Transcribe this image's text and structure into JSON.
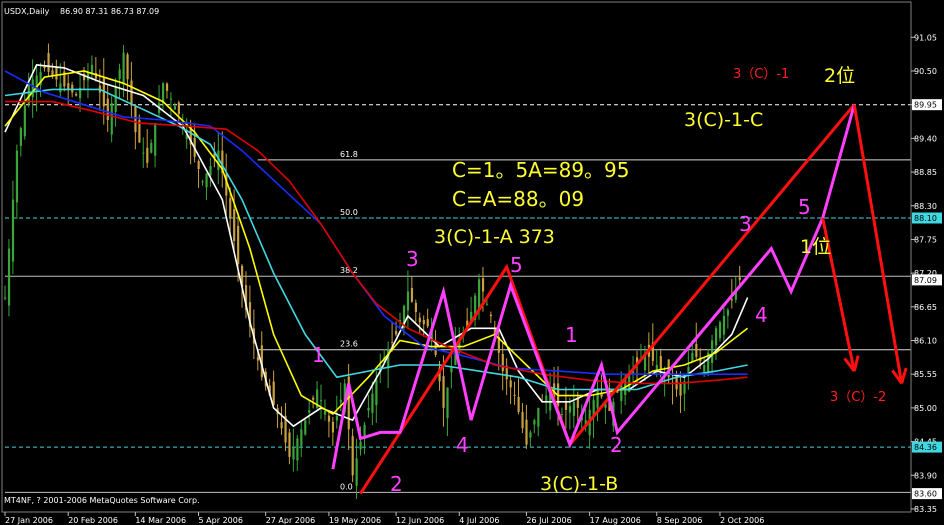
{
  "header": {
    "symbol": "USDX,Daily",
    "ohlc": "86.90 87.31 86.73 87.09"
  },
  "footer": {
    "copyright": "MT4NF, ? 2001-2006 MetaQuotes Software Corp."
  },
  "colors": {
    "background": "#000000",
    "bull": "#3aa63a",
    "bear": "#c8a040",
    "ma_white": "#ffffff",
    "ma_yellow": "#ffff00",
    "ma_cyan": "#40d8e0",
    "ma_blue": "#1a2cff",
    "ma_red": "#e00000",
    "wave_magenta": "#ff40ff",
    "trend_red": "#ff1010",
    "annot_yellow": "#ffff30",
    "label_red": "#ff2020"
  },
  "chart_data": {
    "type": "candlestick",
    "title": "USDX,Daily",
    "ylim": [
      83.3,
      91.3
    ],
    "y_ticks": [
      91.05,
      90.5,
      89.95,
      89.4,
      88.85,
      88.3,
      87.75,
      87.2,
      86.65,
      86.1,
      85.55,
      85.0,
      84.45,
      83.9,
      83.35
    ],
    "y_tick_labels": [
      "91.05",
      "90.50",
      "89.95",
      "89.40",
      "88.85",
      "88.30",
      "87.75",
      "87.20",
      "86.65",
      "86.10",
      "85.55",
      "85.00",
      "84.45",
      "83.90",
      "83.35"
    ],
    "x_ticks": [
      {
        "i": 0,
        "label": "27 Jan 2006"
      },
      {
        "i": 16,
        "label": "20 Feb 2006"
      },
      {
        "i": 33,
        "label": "14 Mar 2006"
      },
      {
        "i": 49,
        "label": "5 Apr 2006"
      },
      {
        "i": 66,
        "label": "27 Apr 2006"
      },
      {
        "i": 82,
        "label": "19 May 2006"
      },
      {
        "i": 99,
        "label": "12 Jun 2006"
      },
      {
        "i": 115,
        "label": "4 Jul 2006"
      },
      {
        "i": 132,
        "label": "26 Jul 2006"
      },
      {
        "i": 148,
        "label": "17 Aug 2006"
      },
      {
        "i": 165,
        "label": "8 Sep 2006"
      },
      {
        "i": 181,
        "label": "2 Oct 2006"
      }
    ],
    "price_anchors": [
      [
        0,
        86.8
      ],
      [
        3,
        89.2
      ],
      [
        6,
        90.3
      ],
      [
        10,
        90.55
      ],
      [
        14,
        90.3
      ],
      [
        18,
        90.1
      ],
      [
        22,
        90.6
      ],
      [
        26,
        89.7
      ],
      [
        30,
        90.8
      ],
      [
        33,
        89.5
      ],
      [
        36,
        89.0
      ],
      [
        40,
        90.3
      ],
      [
        44,
        89.8
      ],
      [
        47,
        89.3
      ],
      [
        50,
        88.7
      ],
      [
        54,
        89.2
      ],
      [
        57,
        88.1
      ],
      [
        61,
        86.6
      ],
      [
        65,
        85.5
      ],
      [
        69,
        84.9
      ],
      [
        72,
        84.2
      ],
      [
        76,
        84.8
      ],
      [
        79,
        85.3
      ],
      [
        83,
        84.6
      ],
      [
        86,
        85.4
      ],
      [
        88,
        83.9
      ],
      [
        92,
        85.0
      ],
      [
        95,
        85.7
      ],
      [
        99,
        86.2
      ],
      [
        102,
        86.9
      ],
      [
        105,
        86.4
      ],
      [
        108,
        86.3
      ],
      [
        111,
        85.0
      ],
      [
        114,
        86.0
      ],
      [
        117,
        86.3
      ],
      [
        120,
        87.1
      ],
      [
        123,
        86.5
      ],
      [
        126,
        85.6
      ],
      [
        129,
        85.2
      ],
      [
        132,
        84.4
      ],
      [
        135,
        85.0
      ],
      [
        138,
        85.3
      ],
      [
        141,
        84.9
      ],
      [
        144,
        85.1
      ],
      [
        147,
        84.8
      ],
      [
        150,
        85.3
      ],
      [
        153,
        84.95
      ],
      [
        156,
        85.4
      ],
      [
        159,
        85.6
      ],
      [
        162,
        85.9
      ],
      [
        165,
        85.7
      ],
      [
        168,
        85.5
      ],
      [
        171,
        85.2
      ],
      [
        174,
        85.9
      ],
      [
        177,
        85.7
      ],
      [
        180,
        86.3
      ],
      [
        183,
        86.6
      ],
      [
        186,
        87.09
      ]
    ],
    "moving_averages": [
      {
        "name": "MA white",
        "color": "#ffffff",
        "points": [
          [
            0,
            89.5
          ],
          [
            8,
            90.6
          ],
          [
            15,
            90.55
          ],
          [
            25,
            90.3
          ],
          [
            35,
            90.1
          ],
          [
            45,
            89.6
          ],
          [
            55,
            88.4
          ],
          [
            62,
            86.4
          ],
          [
            68,
            85.0
          ],
          [
            73,
            84.7
          ],
          [
            80,
            85.0
          ],
          [
            88,
            84.8
          ],
          [
            95,
            85.6
          ],
          [
            102,
            86.5
          ],
          [
            110,
            86.0
          ],
          [
            118,
            86.3
          ],
          [
            125,
            86.3
          ],
          [
            130,
            85.6
          ],
          [
            136,
            85.1
          ],
          [
            143,
            85.1
          ],
          [
            150,
            85.3
          ],
          [
            158,
            85.3
          ],
          [
            165,
            85.6
          ],
          [
            172,
            85.5
          ],
          [
            178,
            85.8
          ],
          [
            184,
            86.2
          ],
          [
            188,
            86.8
          ]
        ]
      },
      {
        "name": "MA yellow",
        "color": "#ffff00",
        "points": [
          [
            0,
            89.6
          ],
          [
            10,
            90.4
          ],
          [
            20,
            90.5
          ],
          [
            30,
            90.3
          ],
          [
            40,
            90.0
          ],
          [
            48,
            89.5
          ],
          [
            55,
            88.9
          ],
          [
            62,
            87.6
          ],
          [
            68,
            86.2
          ],
          [
            75,
            85.2
          ],
          [
            83,
            84.9
          ],
          [
            92,
            85.5
          ],
          [
            100,
            86.1
          ],
          [
            108,
            86.0
          ],
          [
            116,
            86.0
          ],
          [
            124,
            86.2
          ],
          [
            132,
            85.7
          ],
          [
            140,
            85.2
          ],
          [
            148,
            85.2
          ],
          [
            156,
            85.3
          ],
          [
            164,
            85.6
          ],
          [
            172,
            85.7
          ],
          [
            180,
            85.9
          ],
          [
            188,
            86.3
          ]
        ]
      },
      {
        "name": "MA cyan",
        "color": "#40d8e0",
        "points": [
          [
            0,
            90.1
          ],
          [
            12,
            90.2
          ],
          [
            24,
            90.2
          ],
          [
            34,
            89.9
          ],
          [
            44,
            89.6
          ],
          [
            52,
            89.3
          ],
          [
            60,
            88.4
          ],
          [
            68,
            87.2
          ],
          [
            76,
            86.2
          ],
          [
            84,
            85.5
          ],
          [
            92,
            85.6
          ],
          [
            100,
            85.7
          ],
          [
            110,
            85.7
          ],
          [
            120,
            85.6
          ],
          [
            130,
            85.5
          ],
          [
            140,
            85.3
          ],
          [
            150,
            85.3
          ],
          [
            160,
            85.3
          ],
          [
            170,
            85.5
          ],
          [
            180,
            85.6
          ],
          [
            188,
            85.7
          ]
        ]
      },
      {
        "name": "MA blue",
        "color": "#1a2cff",
        "points": [
          [
            0,
            90.5
          ],
          [
            10,
            90.15
          ],
          [
            20,
            89.95
          ],
          [
            30,
            89.75
          ],
          [
            40,
            89.7
          ],
          [
            52,
            89.6
          ],
          [
            60,
            89.2
          ],
          [
            70,
            88.6
          ],
          [
            80,
            88.0
          ],
          [
            88,
            87.2
          ],
          [
            96,
            86.5
          ],
          [
            106,
            86.0
          ],
          [
            116,
            85.85
          ],
          [
            128,
            85.65
          ],
          [
            140,
            85.6
          ],
          [
            152,
            85.55
          ],
          [
            164,
            85.55
          ],
          [
            176,
            85.55
          ],
          [
            188,
            85.55
          ]
        ]
      },
      {
        "name": "MA red",
        "color": "#e00000",
        "points": [
          [
            0,
            90.0
          ],
          [
            12,
            90.0
          ],
          [
            22,
            89.85
          ],
          [
            34,
            89.65
          ],
          [
            46,
            89.6
          ],
          [
            56,
            89.55
          ],
          [
            64,
            89.2
          ],
          [
            72,
            88.7
          ],
          [
            80,
            88.0
          ],
          [
            88,
            87.2
          ],
          [
            94,
            86.7
          ],
          [
            102,
            86.3
          ],
          [
            112,
            86.0
          ],
          [
            124,
            85.7
          ],
          [
            136,
            85.55
          ],
          [
            148,
            85.45
          ],
          [
            160,
            85.4
          ],
          [
            170,
            85.4
          ],
          [
            180,
            85.45
          ],
          [
            188,
            85.5
          ]
        ]
      }
    ],
    "fib_levels": [
      {
        "label": "61.8",
        "value": 89.05
      },
      {
        "label": "50.0",
        "value": 88.1
      },
      {
        "label": "38.2",
        "value": 87.15
      },
      {
        "label": "23.6",
        "value": 85.95
      },
      {
        "label": "0.0",
        "value": 83.62
      }
    ],
    "price_boxes": [
      {
        "label": "89.95",
        "value": 89.95,
        "bg": "#ffffff",
        "fg": "#000000"
      },
      {
        "label": "88.10",
        "value": 88.1,
        "bg": "#40d8e0",
        "fg": "#000000"
      },
      {
        "label": "87.09",
        "value": 87.09,
        "bg": "#ffffff",
        "fg": "#000000"
      },
      {
        "label": "84.36",
        "value": 84.36,
        "bg": "#40d8e0",
        "fg": "#000000"
      },
      {
        "label": "83.60",
        "value": 83.6,
        "bg": "#ffffff",
        "fg": "#000000"
      }
    ],
    "hlines": [
      {
        "value": 89.95,
        "color": "#ffffff",
        "dash": "4,3"
      },
      {
        "value": 88.1,
        "color": "#40d8e0",
        "dash": "4,3"
      },
      {
        "value": 87.15,
        "color": "#c0c0c0",
        "dash": ""
      },
      {
        "value": 84.36,
        "color": "#40d8e0",
        "dash": "4,3"
      },
      {
        "value": 83.62,
        "color": "#c0c0c0",
        "dash": ""
      }
    ],
    "waves": {
      "red_trend": [
        [
          90,
          83.6
        ],
        [
          127,
          87.3
        ],
        [
          143,
          84.4
        ],
        [
          215,
          89.95
        ]
      ],
      "magenta": [
        [
          83,
          84.0
        ],
        [
          87,
          85.4
        ],
        [
          90,
          84.5
        ],
        [
          95,
          84.6
        ],
        [
          100,
          84.6
        ],
        [
          111,
          86.9
        ],
        [
          118,
          84.8
        ],
        [
          128,
          87.0
        ],
        [
          143,
          84.4
        ],
        [
          151,
          85.7
        ],
        [
          155,
          84.6
        ],
        [
          194,
          87.6
        ],
        [
          199,
          86.9
        ],
        [
          207,
          88.1
        ],
        [
          215,
          89.95
        ]
      ],
      "red_arrows": [
        {
          "from": [
            207,
            88.1
          ],
          "to": [
            215,
            85.6
          ]
        },
        {
          "from": [
            215,
            89.95
          ],
          "to": [
            227,
            85.4
          ]
        }
      ]
    },
    "annotations": [
      {
        "text": "C=1。5A=89。95",
        "color": "#ffff30",
        "size": 20
      },
      {
        "text": "C=A=88。09",
        "color": "#ffff30",
        "size": 20
      },
      {
        "text": "3(C)-1-A   373",
        "color": "#ffff30",
        "size": 19
      },
      {
        "text": "3(C)-1-B",
        "color": "#ffff30",
        "size": 19
      },
      {
        "text": "3(C)-1-C",
        "color": "#ffff30",
        "size": 19
      },
      {
        "text": "3（C）-1",
        "color": "#ff2020",
        "size": 13
      },
      {
        "text": "2位",
        "color": "#ffff30",
        "size": 19
      },
      {
        "text": "1位",
        "color": "#ffff30",
        "size": 19
      },
      {
        "text": "3（C）-2",
        "color": "#ff2020",
        "size": 13
      },
      {
        "text": "1",
        "color": "#ff40ff",
        "size": 20
      },
      {
        "text": "2",
        "color": "#ff40ff",
        "size": 20
      },
      {
        "text": "3",
        "color": "#ff40ff",
        "size": 20
      },
      {
        "text": "4",
        "color": "#ff40ff",
        "size": 20
      },
      {
        "text": "5",
        "color": "#ff40ff",
        "size": 20
      },
      {
        "text": "1",
        "color": "#ff40ff",
        "size": 20
      },
      {
        "text": "2",
        "color": "#ff40ff",
        "size": 20
      },
      {
        "text": "3",
        "color": "#ff40ff",
        "size": 20
      },
      {
        "text": "4",
        "color": "#ff40ff",
        "size": 20
      },
      {
        "text": "5",
        "color": "#ff40ff",
        "size": 20
      }
    ]
  }
}
